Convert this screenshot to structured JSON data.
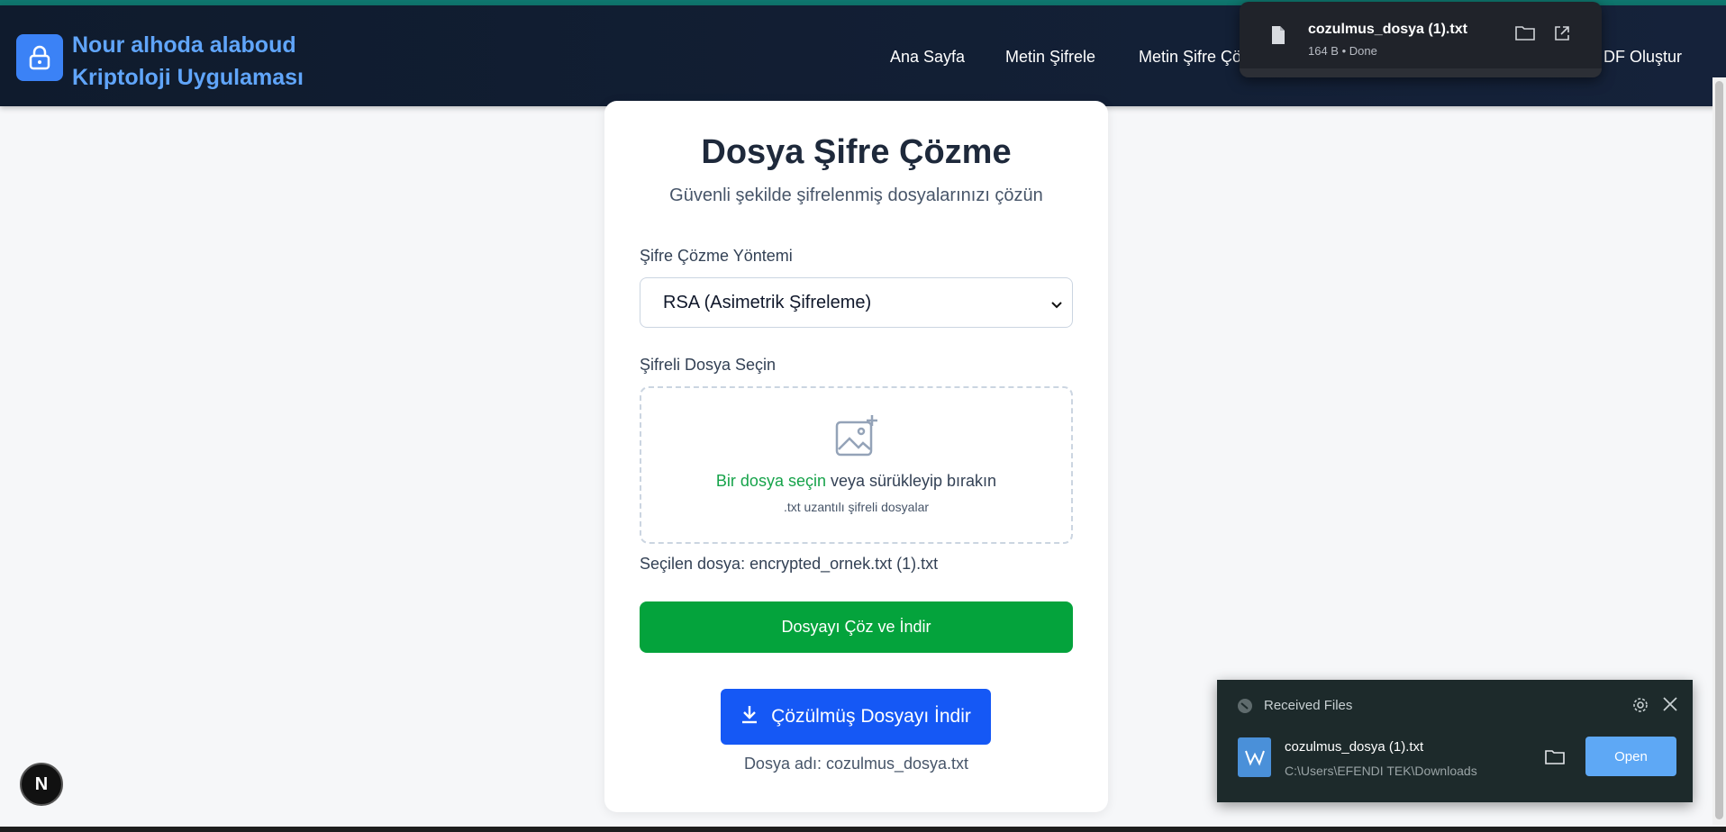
{
  "brand": {
    "line1": "Nour alhoda alaboud",
    "line2": "Kriptoloji Uygulaması",
    "icon": "lock-icon"
  },
  "nav": {
    "items": [
      {
        "label": "Ana Sayfa"
      },
      {
        "label": "Metin Şifrele"
      },
      {
        "label": "Metin Şifre Çö"
      },
      {
        "label": "DF Oluştur"
      }
    ]
  },
  "download_popup": {
    "filename": "cozulmus_dosya (1).txt",
    "status": "164 B • Done"
  },
  "page": {
    "title": "Dosya Şifre Çözme",
    "subtitle": "Güvenli şekilde şifrelenmiş dosyalarınızı çözün",
    "method_label": "Şifre Çözme Yöntemi",
    "method_selected": "RSA (Asimetrik Şifreleme)",
    "file_label": "Şifreli Dosya Seçin",
    "dropzone": {
      "link": "Bir dosya seçin",
      "text": " veya sürükleyip bırakın",
      "hint": ".txt uzantılı şifreli dosyalar"
    },
    "selected_file": "Seçilen dosya: encrypted_ornek.txt (1).txt",
    "decrypt_button": "Dosyayı Çöz ve İndir",
    "download_button": "Çözülmüş Dosyayı İndir",
    "filename_text": "Dosya adı: cozulmus_dosya.txt"
  },
  "toast": {
    "title": "Received Files",
    "filename": "cozulmus_dosya (1).txt",
    "path": "C:\\Users\\EFENDI TEK\\Downloads",
    "open_label": "Open"
  },
  "next_badge": "N",
  "colors": {
    "nav_bg": "#0f1b2d",
    "brand_text": "#60a5fa",
    "decrypt_green": "#04a33c",
    "download_blue": "#1558f5",
    "link_green": "#16a34a"
  }
}
